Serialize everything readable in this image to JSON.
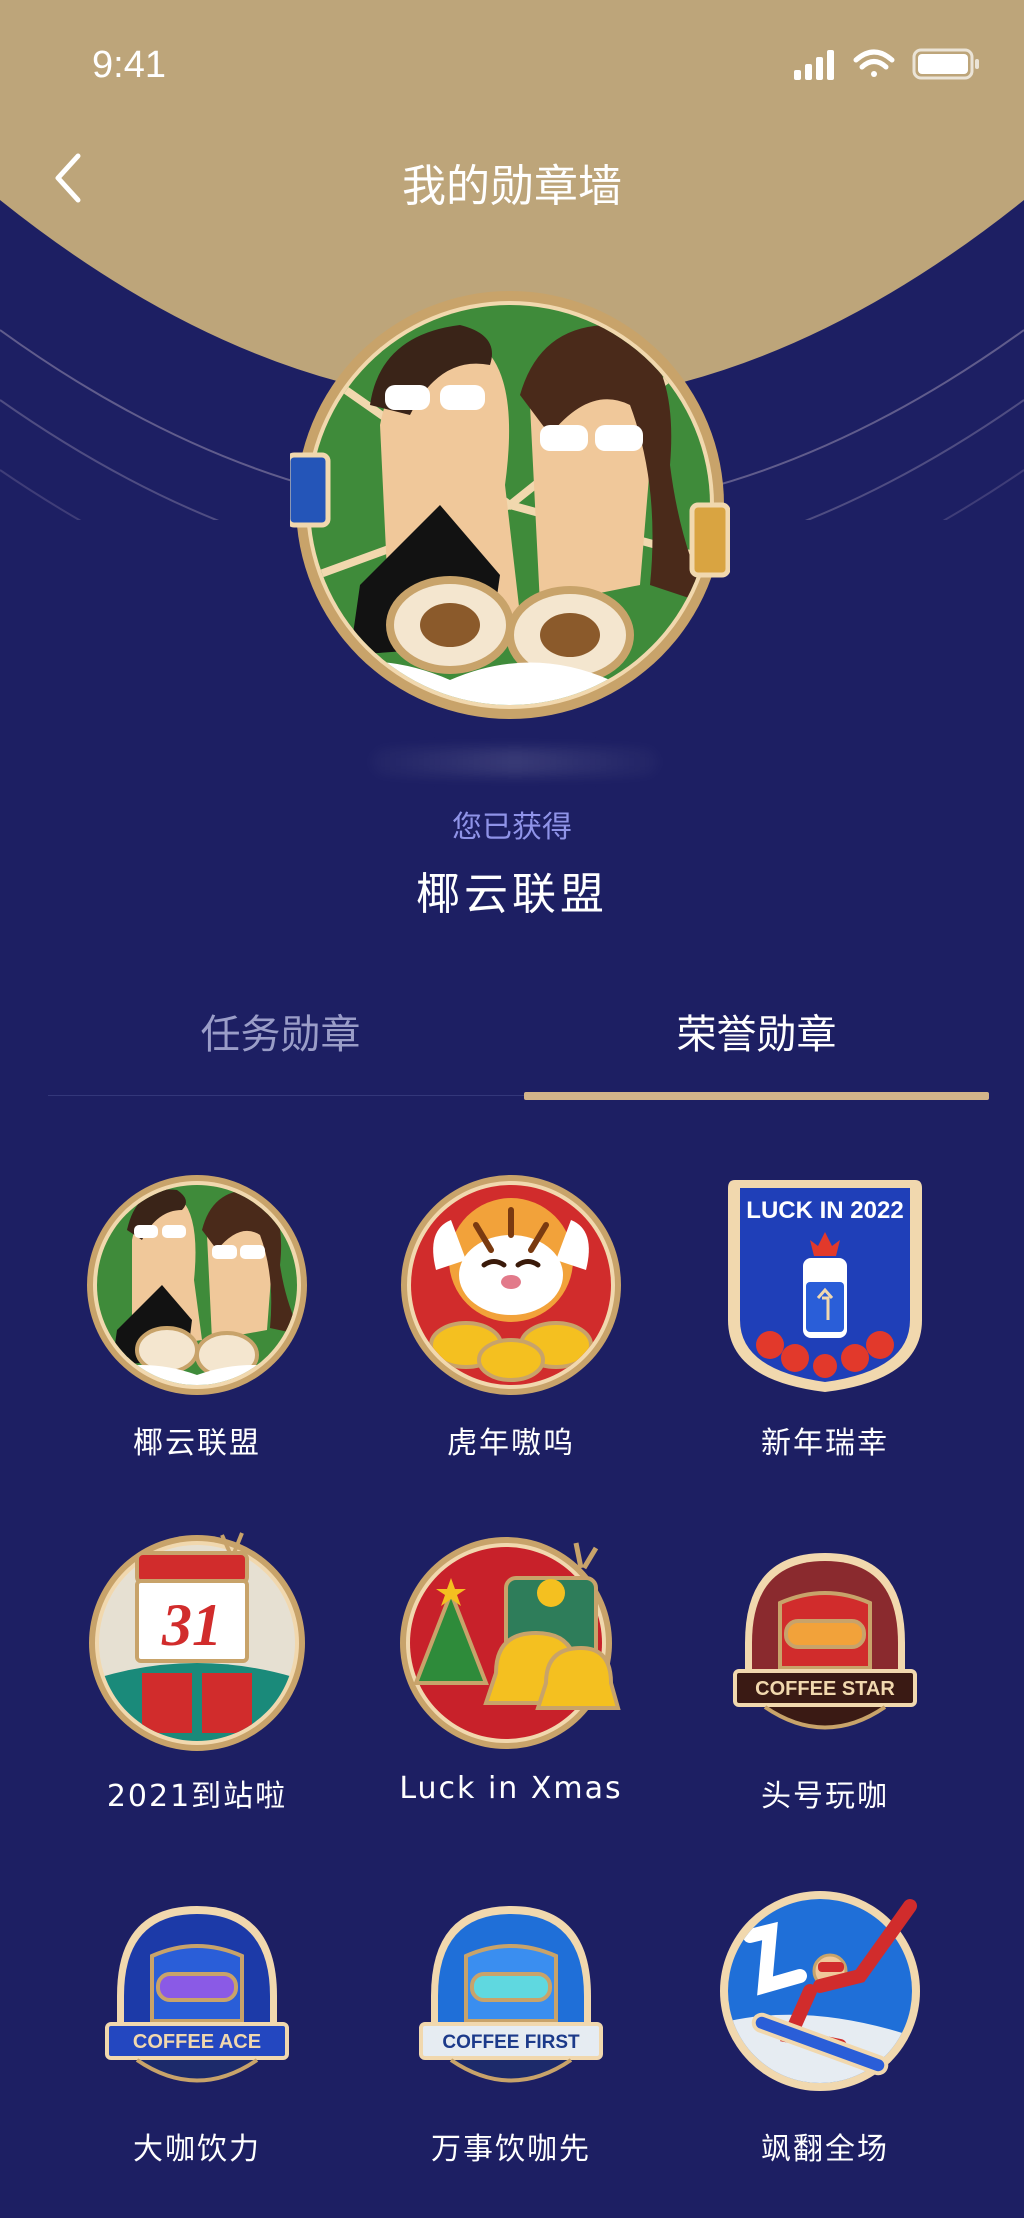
{
  "status": {
    "time": "9:41"
  },
  "nav": {
    "title": "我的勋章墙",
    "back_icon": "chevron-left-icon"
  },
  "hero": {
    "earned_label": "您已获得",
    "badge_name": "椰云联盟"
  },
  "tabs": [
    {
      "label": "任务勋章",
      "active": false
    },
    {
      "label": "荣誉勋章",
      "active": true
    }
  ],
  "badges": [
    {
      "label": "椰云联盟",
      "icon": "coconut-alliance-badge-icon"
    },
    {
      "label": "虎年嗷呜",
      "icon": "tiger-year-badge-icon"
    },
    {
      "label": "新年瑞幸",
      "icon": "luck-in-2022-badge-icon",
      "text": "LUCK IN 2022"
    },
    {
      "label": "2021到站啦",
      "icon": "calendar-31-badge-icon",
      "text": "31"
    },
    {
      "label": "Luck in Xmas",
      "icon": "xmas-bells-badge-icon"
    },
    {
      "label": "头号玩咖",
      "icon": "coffee-star-badge-icon",
      "text": "COFFEE STAR"
    },
    {
      "label": "大咖饮力",
      "icon": "coffee-ace-badge-icon",
      "text": "COFFEE ACE"
    },
    {
      "label": "万事饮咖先",
      "icon": "coffee-first-badge-icon",
      "text": "COFFEE FIRST"
    },
    {
      "label": "飒翻全场",
      "icon": "snowboard-badge-icon"
    }
  ],
  "colors": {
    "background": "#1d1f63",
    "gold": "#bda57a",
    "tab_underline": "#d2b48a",
    "muted_text": "#8f93e8"
  }
}
